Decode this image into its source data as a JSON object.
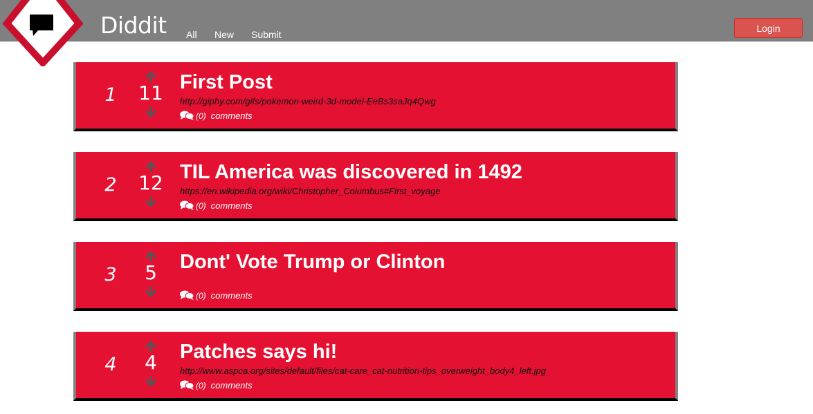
{
  "header": {
    "brand": "Diddit",
    "nav": [
      {
        "label": "All"
      },
      {
        "label": "New"
      },
      {
        "label": "Submit"
      }
    ],
    "login_label": "Login",
    "logo_icon": "chat-bubble-diamond-icon"
  },
  "colors": {
    "header_bg": "#808080",
    "post_bg": "#e41132",
    "login_bg": "#d9534f",
    "logo_accent": "#c8102e"
  },
  "posts": [
    {
      "rank": "1",
      "score": "11",
      "title": "First Post",
      "url": "http://giphy.com/gifs/pokemon-weird-3d-model-EeBs3saJq4Qwg",
      "comment_count": "(0)",
      "comments_label": "comments"
    },
    {
      "rank": "2",
      "score": "12",
      "title": "TIL America was discovered in 1492",
      "url": "https://en.wikipedia.org/wiki/Christopher_Columbus#First_voyage",
      "comment_count": "(0)",
      "comments_label": "comments"
    },
    {
      "rank": "3",
      "score": "5",
      "title": "Dont' Vote Trump or Clinton",
      "url": "",
      "comment_count": "(0)",
      "comments_label": "comments"
    },
    {
      "rank": "4",
      "score": "4",
      "title": "Patches says hi!",
      "url": "http://www.aspca.org/sites/default/files/cat-care_cat-nutrition-tips_overweight_body4_left.jpg",
      "comment_count": "(0)",
      "comments_label": "comments"
    }
  ]
}
